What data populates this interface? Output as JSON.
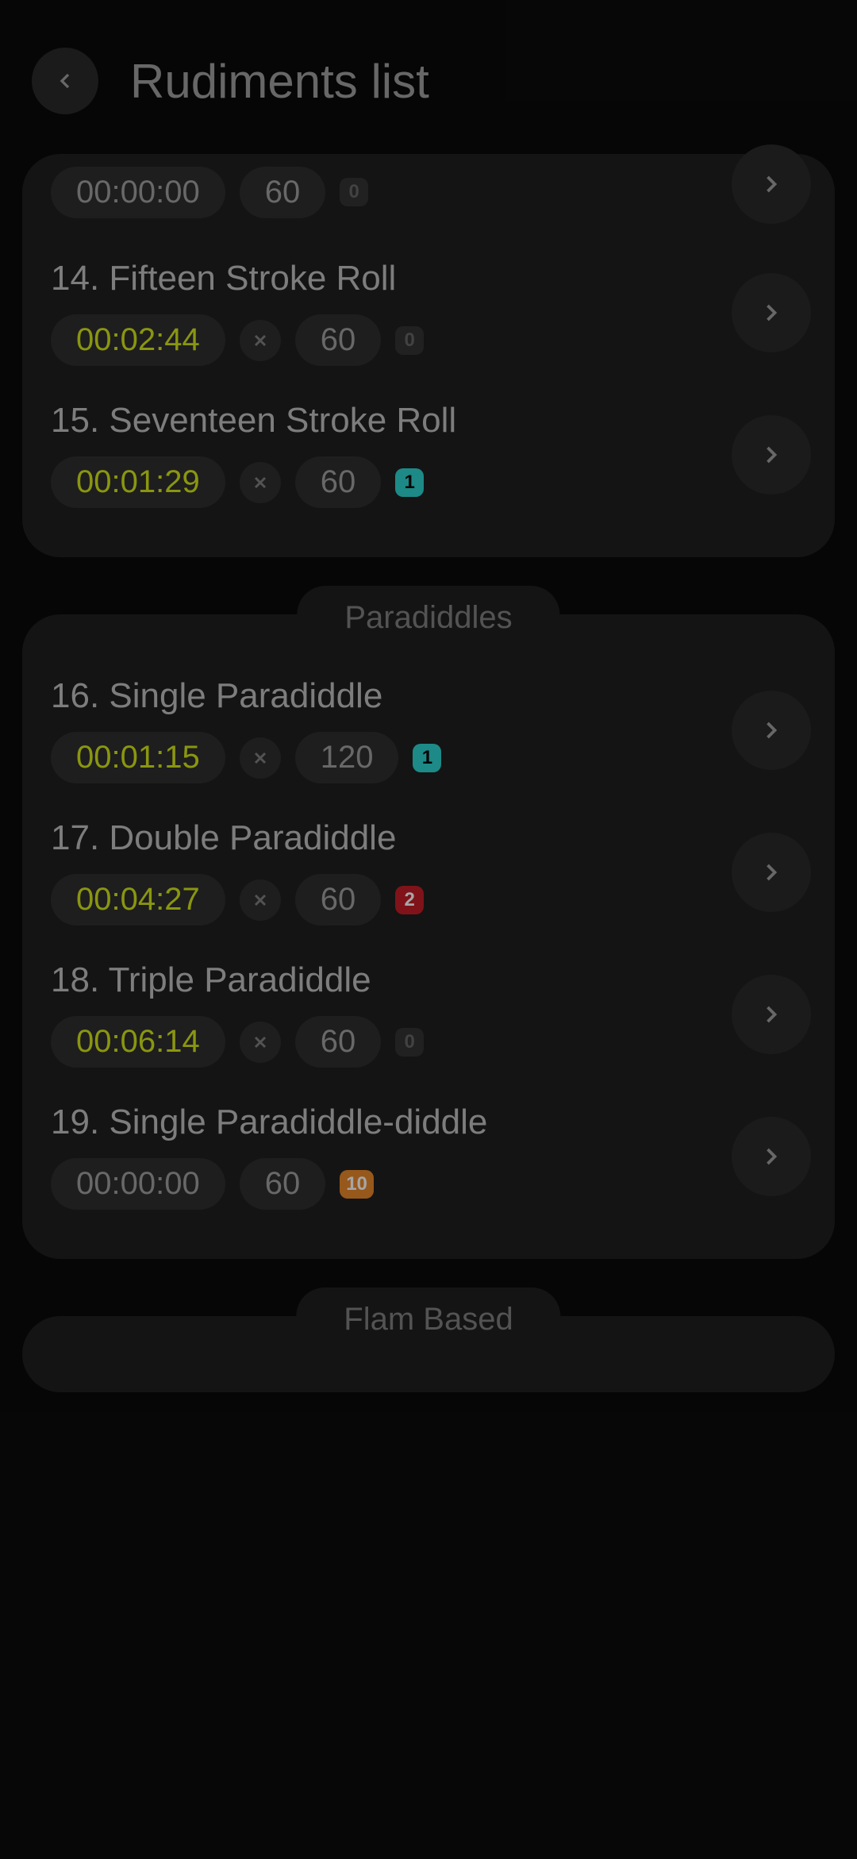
{
  "header": {
    "title": "Rudiments list"
  },
  "groups": [
    {
      "label": null,
      "items": [
        {
          "num": "",
          "name": "",
          "time": "00:00:00",
          "timeActive": false,
          "showClose": false,
          "tempo": "60",
          "badge": "0",
          "badgeClass": "badge-zero",
          "first": true
        },
        {
          "num": "14.",
          "name": "Fifteen Stroke Roll",
          "time": "00:02:44",
          "timeActive": true,
          "showClose": true,
          "tempo": "60",
          "badge": "0",
          "badgeClass": "badge-zero"
        },
        {
          "num": "15.",
          "name": "Seventeen Stroke Roll",
          "time": "00:01:29",
          "timeActive": true,
          "showClose": true,
          "tempo": "60",
          "badge": "1",
          "badgeClass": "badge-teal"
        }
      ]
    },
    {
      "label": "Paradiddles",
      "items": [
        {
          "num": "16.",
          "name": "Single Paradiddle",
          "time": "00:01:15",
          "timeActive": true,
          "showClose": true,
          "tempo": "120",
          "badge": "1",
          "badgeClass": "badge-teal"
        },
        {
          "num": "17.",
          "name": "Double Paradiddle",
          "time": "00:04:27",
          "timeActive": true,
          "showClose": true,
          "tempo": "60",
          "badge": "2",
          "badgeClass": "badge-red"
        },
        {
          "num": "18.",
          "name": "Triple Paradiddle",
          "time": "00:06:14",
          "timeActive": true,
          "showClose": true,
          "tempo": "60",
          "badge": "0",
          "badgeClass": "badge-zero"
        },
        {
          "num": "19.",
          "name": "Single Paradiddle-diddle",
          "time": "00:00:00",
          "timeActive": false,
          "showClose": false,
          "tempo": "60",
          "badge": "10",
          "badgeClass": "badge-orange"
        }
      ]
    },
    {
      "label": "Flam Based",
      "items": []
    }
  ]
}
